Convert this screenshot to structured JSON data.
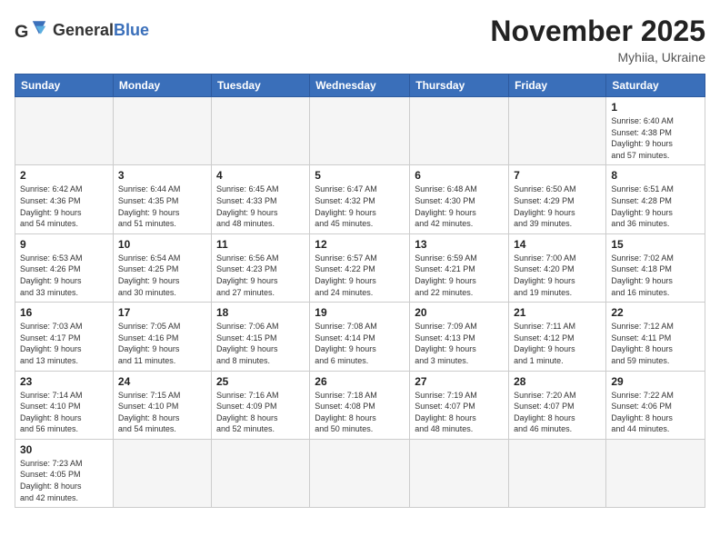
{
  "header": {
    "logo": {
      "general": "General",
      "blue": "Blue"
    },
    "title": "November 2025",
    "location": "Myhiia, Ukraine"
  },
  "weekdays": [
    "Sunday",
    "Monday",
    "Tuesday",
    "Wednesday",
    "Thursday",
    "Friday",
    "Saturday"
  ],
  "weeks": [
    [
      {
        "day": "",
        "info": ""
      },
      {
        "day": "",
        "info": ""
      },
      {
        "day": "",
        "info": ""
      },
      {
        "day": "",
        "info": ""
      },
      {
        "day": "",
        "info": ""
      },
      {
        "day": "",
        "info": ""
      },
      {
        "day": "1",
        "info": "Sunrise: 6:40 AM\nSunset: 4:38 PM\nDaylight: 9 hours\nand 57 minutes."
      }
    ],
    [
      {
        "day": "2",
        "info": "Sunrise: 6:42 AM\nSunset: 4:36 PM\nDaylight: 9 hours\nand 54 minutes."
      },
      {
        "day": "3",
        "info": "Sunrise: 6:44 AM\nSunset: 4:35 PM\nDaylight: 9 hours\nand 51 minutes."
      },
      {
        "day": "4",
        "info": "Sunrise: 6:45 AM\nSunset: 4:33 PM\nDaylight: 9 hours\nand 48 minutes."
      },
      {
        "day": "5",
        "info": "Sunrise: 6:47 AM\nSunset: 4:32 PM\nDaylight: 9 hours\nand 45 minutes."
      },
      {
        "day": "6",
        "info": "Sunrise: 6:48 AM\nSunset: 4:30 PM\nDaylight: 9 hours\nand 42 minutes."
      },
      {
        "day": "7",
        "info": "Sunrise: 6:50 AM\nSunset: 4:29 PM\nDaylight: 9 hours\nand 39 minutes."
      },
      {
        "day": "8",
        "info": "Sunrise: 6:51 AM\nSunset: 4:28 PM\nDaylight: 9 hours\nand 36 minutes."
      }
    ],
    [
      {
        "day": "9",
        "info": "Sunrise: 6:53 AM\nSunset: 4:26 PM\nDaylight: 9 hours\nand 33 minutes."
      },
      {
        "day": "10",
        "info": "Sunrise: 6:54 AM\nSunset: 4:25 PM\nDaylight: 9 hours\nand 30 minutes."
      },
      {
        "day": "11",
        "info": "Sunrise: 6:56 AM\nSunset: 4:23 PM\nDaylight: 9 hours\nand 27 minutes."
      },
      {
        "day": "12",
        "info": "Sunrise: 6:57 AM\nSunset: 4:22 PM\nDaylight: 9 hours\nand 24 minutes."
      },
      {
        "day": "13",
        "info": "Sunrise: 6:59 AM\nSunset: 4:21 PM\nDaylight: 9 hours\nand 22 minutes."
      },
      {
        "day": "14",
        "info": "Sunrise: 7:00 AM\nSunset: 4:20 PM\nDaylight: 9 hours\nand 19 minutes."
      },
      {
        "day": "15",
        "info": "Sunrise: 7:02 AM\nSunset: 4:18 PM\nDaylight: 9 hours\nand 16 minutes."
      }
    ],
    [
      {
        "day": "16",
        "info": "Sunrise: 7:03 AM\nSunset: 4:17 PM\nDaylight: 9 hours\nand 13 minutes."
      },
      {
        "day": "17",
        "info": "Sunrise: 7:05 AM\nSunset: 4:16 PM\nDaylight: 9 hours\nand 11 minutes."
      },
      {
        "day": "18",
        "info": "Sunrise: 7:06 AM\nSunset: 4:15 PM\nDaylight: 9 hours\nand 8 minutes."
      },
      {
        "day": "19",
        "info": "Sunrise: 7:08 AM\nSunset: 4:14 PM\nDaylight: 9 hours\nand 6 minutes."
      },
      {
        "day": "20",
        "info": "Sunrise: 7:09 AM\nSunset: 4:13 PM\nDaylight: 9 hours\nand 3 minutes."
      },
      {
        "day": "21",
        "info": "Sunrise: 7:11 AM\nSunset: 4:12 PM\nDaylight: 9 hours\nand 1 minute."
      },
      {
        "day": "22",
        "info": "Sunrise: 7:12 AM\nSunset: 4:11 PM\nDaylight: 8 hours\nand 59 minutes."
      }
    ],
    [
      {
        "day": "23",
        "info": "Sunrise: 7:14 AM\nSunset: 4:10 PM\nDaylight: 8 hours\nand 56 minutes."
      },
      {
        "day": "24",
        "info": "Sunrise: 7:15 AM\nSunset: 4:10 PM\nDaylight: 8 hours\nand 54 minutes."
      },
      {
        "day": "25",
        "info": "Sunrise: 7:16 AM\nSunset: 4:09 PM\nDaylight: 8 hours\nand 52 minutes."
      },
      {
        "day": "26",
        "info": "Sunrise: 7:18 AM\nSunset: 4:08 PM\nDaylight: 8 hours\nand 50 minutes."
      },
      {
        "day": "27",
        "info": "Sunrise: 7:19 AM\nSunset: 4:07 PM\nDaylight: 8 hours\nand 48 minutes."
      },
      {
        "day": "28",
        "info": "Sunrise: 7:20 AM\nSunset: 4:07 PM\nDaylight: 8 hours\nand 46 minutes."
      },
      {
        "day": "29",
        "info": "Sunrise: 7:22 AM\nSunset: 4:06 PM\nDaylight: 8 hours\nand 44 minutes."
      }
    ],
    [
      {
        "day": "30",
        "info": "Sunrise: 7:23 AM\nSunset: 4:05 PM\nDaylight: 8 hours\nand 42 minutes."
      },
      {
        "day": "",
        "info": ""
      },
      {
        "day": "",
        "info": ""
      },
      {
        "day": "",
        "info": ""
      },
      {
        "day": "",
        "info": ""
      },
      {
        "day": "",
        "info": ""
      },
      {
        "day": "",
        "info": ""
      }
    ]
  ]
}
